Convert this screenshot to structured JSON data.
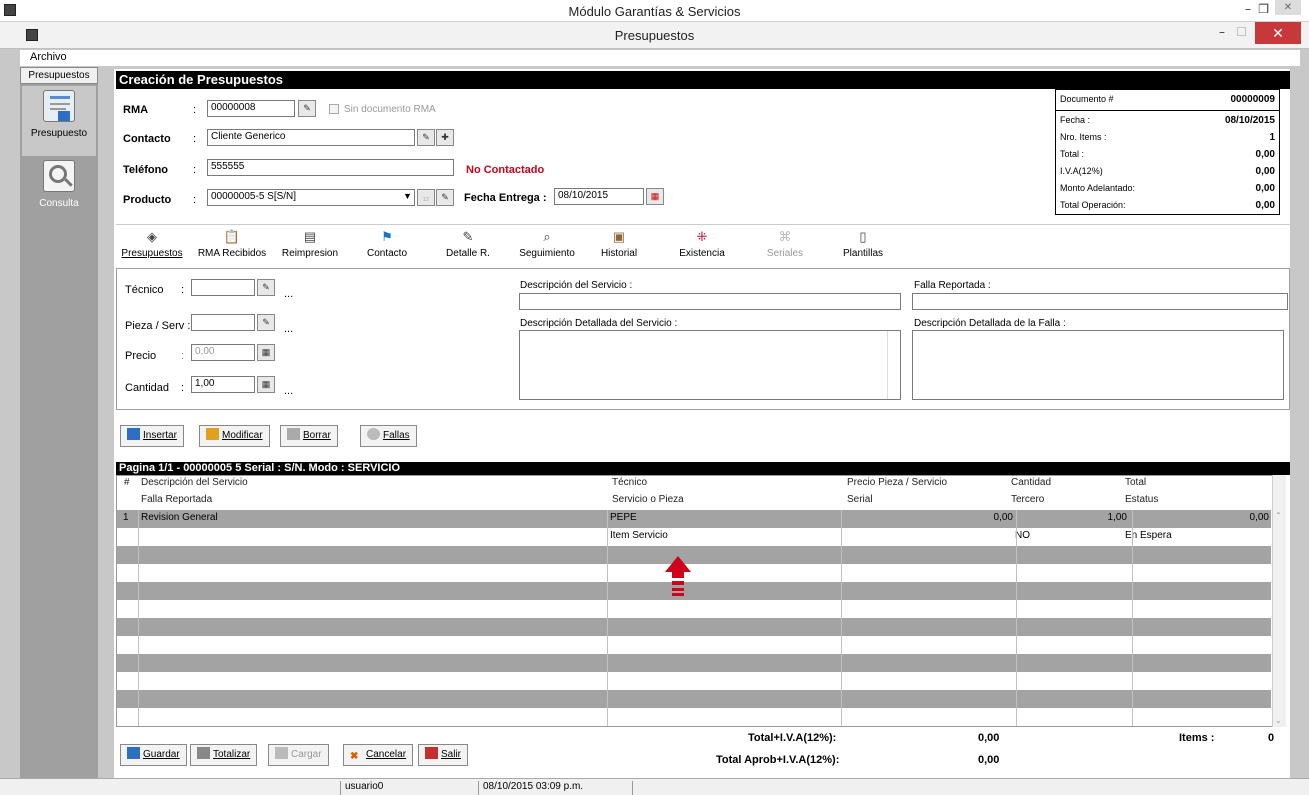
{
  "outer_window": {
    "title": "Módulo Garantías & Servicios"
  },
  "window": {
    "title": "Presupuestos",
    "close": "✕"
  },
  "menu": {
    "archivo": "Archivo"
  },
  "sidebar": {
    "tab": "Presupuestos",
    "items": [
      {
        "label": "Presupuesto"
      },
      {
        "label": "Consulta"
      }
    ]
  },
  "section_title": "Creación de Presupuestos",
  "form": {
    "rma_label": "RMA",
    "rma_value": "00000008",
    "sin_documento_label": "Sin documento RMA",
    "contacto_label": "Contacto",
    "contacto_value": "Cliente Generico",
    "telefono_label": "Teléfono",
    "telefono_value": "555555",
    "no_contactado": "No Contactado",
    "producto_label": "Producto",
    "producto_value": "00000005-5 S[S/N]",
    "fecha_entrega_label": "Fecha Entrega :",
    "fecha_entrega_value": "08/10/2015",
    "colon": ":"
  },
  "summary": {
    "documento_label": "Documento #",
    "documento_value": "00000009",
    "fecha_label": "Fecha :",
    "fecha_value": "08/10/2015",
    "items_label": "Nro. Items :",
    "items_value": "1",
    "total_label": "Total :",
    "total_value": "0,00",
    "iva_label": "I.V.A(12%)",
    "iva_value": "0,00",
    "adelantado_label": "Monto Adelantado:",
    "adelantado_value": "0,00",
    "operacion_label": "Total Operación:",
    "operacion_value": "0,00"
  },
  "toolbar": {
    "presupuestos": "Presupuestos",
    "rma_recibidos": "RMA Recibidos",
    "reimpresion": "Reimpresion",
    "contacto": "Contacto",
    "detalle": "Detalle R.",
    "seguimiento": "Seguimiento",
    "historial": "Historial",
    "existencia": "Existencia",
    "seriales": "Seriales",
    "plantillas": "Plantillas"
  },
  "entry": {
    "tecnico_label": "Técnico",
    "pieza_label": "Pieza / Serv :",
    "precio_label": "Precio",
    "precio_value": "0,00",
    "cantidad_label": "Cantidad",
    "cantidad_value": "1,00",
    "ellipsis": "...",
    "desc_servicio_label": "Descripción del Servicio :",
    "desc_detallada_label": "Descripción Detallada del Servicio :",
    "falla_label": "Falla Reportada :",
    "falla_detallada_label": "Descripción Detallada de la Falla :"
  },
  "actions": {
    "insertar": "Insertar",
    "modificar": "Modificar",
    "borrar": "Borrar",
    "fallas": "Fallas"
  },
  "grid": {
    "header": "Pagina 1/1  -  00000005 5 Serial : S/N.  Modo : SERVICIO",
    "columns_row1": [
      "#",
      "Descripción del Servicio",
      "Técnico",
      "Precio Pieza / Servicio",
      "Cantidad",
      "Total"
    ],
    "columns_row2": [
      "Falla Reportada",
      "Servicio o Pieza",
      "Serial",
      "Tercero",
      "Estatus"
    ],
    "rows": [
      {
        "num": "1",
        "descripcion": "Revision General",
        "tecnico": "PEPE",
        "precio": "0,00",
        "cantidad": "1,00",
        "total": "0,00",
        "servicio_pieza": "Item Servicio",
        "tercero": "NO",
        "estatus": "En Espera"
      }
    ]
  },
  "footer": {
    "guardar": "Guardar",
    "totalizar": "Totalizar",
    "cargar": "Cargar",
    "cancelar": "Cancelar",
    "salir": "Salir",
    "total_iva_label": "Total+I.V.A(12%):",
    "total_iva_value": "0,00",
    "total_aprob_label": "Total Aprob+I.V.A(12%):",
    "total_aprob_value": "0,00",
    "items_label": "Items :",
    "items_value": "0"
  },
  "statusbar": {
    "user": "usuario0",
    "datetime": "08/10/2015 03:09 p.m."
  },
  "colors": {
    "accent_red": "#d0021b",
    "header_black": "#000000",
    "grid_gray": "#a3a3a3"
  }
}
